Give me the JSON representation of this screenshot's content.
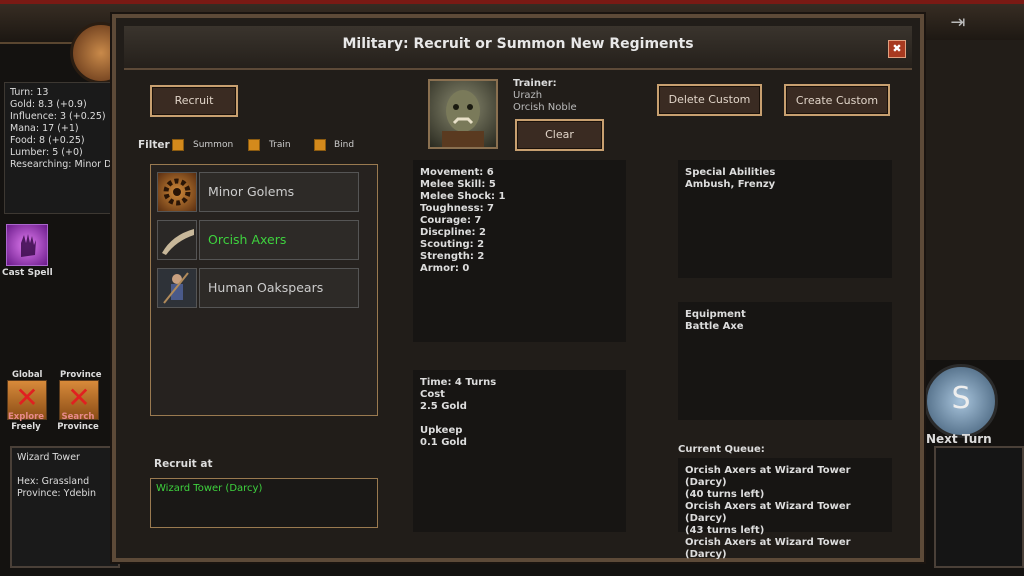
{
  "dialog": {
    "title": "Military: Recruit or Summon New Regiments",
    "close_label": "✖"
  },
  "stats": {
    "turn": "Turn: 13",
    "gold": "Gold: 8.3 (+0.9)",
    "influence": "Influence: 3 (+0.25)",
    "mana": "Mana: 17 (+1)",
    "food": "Food: 8 (+0.25)",
    "lumber": "Lumber: 5 (+0)",
    "researching": "Researching: Minor D"
  },
  "sidebar": {
    "cast_spell": "Cast Spell",
    "global_label": "Global",
    "province_label": "Province",
    "explore_line1": "Explore",
    "explore_line2": "Freely",
    "search_line1": "Search",
    "search_line2": "Province"
  },
  "hex_panel": {
    "name": "Wizard Tower",
    "hex": "Hex: Grassland",
    "province": "Province: Ydebin"
  },
  "next_turn": "Next Turn",
  "buttons": {
    "recruit": "Recruit",
    "clear": "Clear",
    "delete_custom": "Delete Custom",
    "create_custom": "Create Custom"
  },
  "filter": {
    "label": "Filter",
    "summon": "Summon",
    "train": "Train",
    "bind": "Bind"
  },
  "units": [
    {
      "name": "Minor Golems",
      "color": "#c8c8c8"
    },
    {
      "name": "Orcish Axers",
      "color": "#3ed23e"
    },
    {
      "name": "Human Oakspears",
      "color": "#c8c8c8"
    }
  ],
  "recruit_at": {
    "label": "Recruit at",
    "value": "Wizard Tower (Darcy)"
  },
  "trainer": {
    "label": "Trainer:",
    "name": "Urazh",
    "title": "Orcish Noble"
  },
  "unit_stats": [
    "Movement: 6",
    "Melee Skill: 5",
    "Melee Shock: 1",
    "Toughness: 7",
    "Courage: 7",
    "Discpline: 2",
    "Scouting: 2",
    "Strength: 2",
    "Armor: 0"
  ],
  "cost": {
    "time": "Time: 4 Turns",
    "cost_label": "Cost",
    "cost_value": "2.5 Gold",
    "upkeep_label": "Upkeep",
    "upkeep_value": "0.1 Gold"
  },
  "special": {
    "label": "Special Abilities",
    "value": "Ambush, Frenzy"
  },
  "equipment": {
    "label": "Equipment",
    "value": "Battle Axe"
  },
  "queue": {
    "label": "Current Queue:",
    "items": [
      "Orcish Axers at Wizard Tower (Darcy)",
      "(40 turns left)",
      "Orcish Axers at Wizard Tower (Darcy)",
      "(43 turns left)",
      "Orcish Axers at Wizard Tower (Darcy)"
    ]
  }
}
